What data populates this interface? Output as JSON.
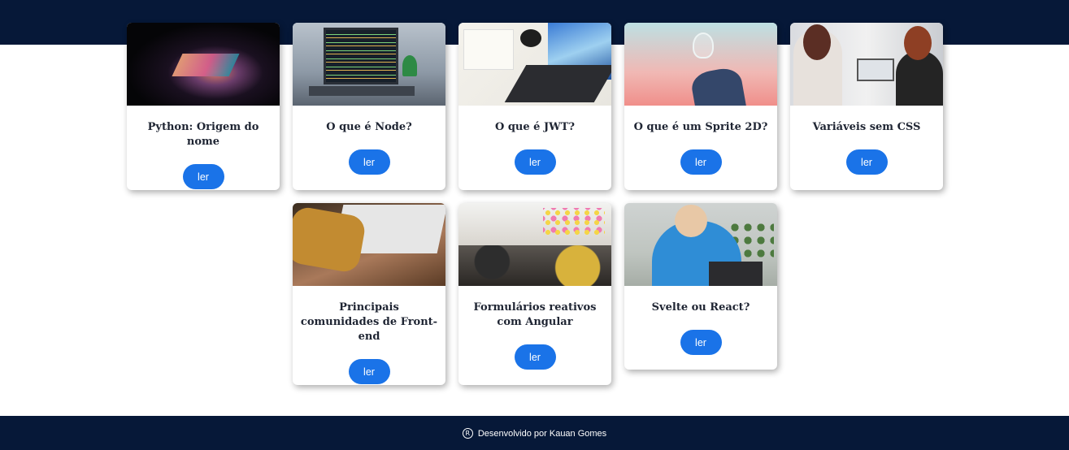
{
  "cards": [
    {
      "title": "Python: Origem do nome",
      "button": "ler"
    },
    {
      "title": "O que é Node?",
      "button": "ler"
    },
    {
      "title": "O que é JWT?",
      "button": "ler"
    },
    {
      "title": "O que é um Sprite 2D?",
      "button": "ler"
    },
    {
      "title": "Variáveis sem CSS",
      "button": "ler"
    },
    {
      "title": "Principais comunidades de Front-end",
      "button": "ler"
    },
    {
      "title": "Formulários reativos com Angular",
      "button": "ler"
    },
    {
      "title": "Svelte ou React?",
      "button": "ler"
    }
  ],
  "footer": {
    "credit": "Desenvolvido por Kauan Gomes",
    "symbol": "R"
  },
  "colors": {
    "navy": "#061838",
    "button": "#1a73e8",
    "title_text": "#1f2533"
  }
}
